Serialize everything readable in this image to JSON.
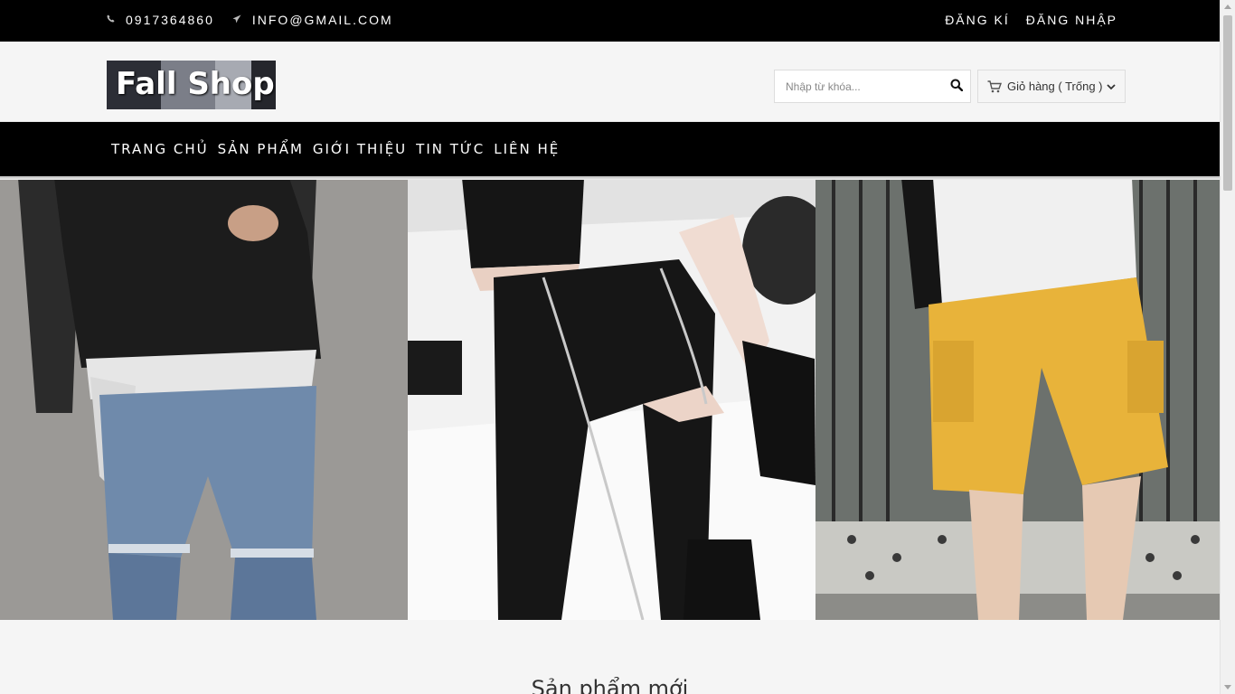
{
  "topbar": {
    "phone": "0917364860",
    "email": "INFO@GMAIL.COM",
    "register_label": "ĐĂNG KÍ",
    "login_label": "ĐĂNG NHẬP"
  },
  "header": {
    "logo_text": "Fall Shop",
    "search_placeholder": "Nhập từ khóa...",
    "cart_label": "Giỏ hàng ( Trống )"
  },
  "nav": {
    "items": [
      {
        "label": "TRANG CHỦ"
      },
      {
        "label": "SẢN PHẨM"
      },
      {
        "label": "GIỚI THIỆU"
      },
      {
        "label": "TIN TỨC"
      },
      {
        "label": "LIÊN HỆ"
      }
    ]
  },
  "section": {
    "title": "Sản phẩm mới"
  },
  "colors": {
    "topbar_bg": "#000000",
    "nav_bg": "#000000",
    "page_bg": "#f5f5f5",
    "shorts_yellow": "#e8b33a"
  },
  "icons": {
    "phone": "phone-icon",
    "email": "paper-plane-icon",
    "search": "search-icon",
    "cart": "cart-icon",
    "dropdown": "chevron-down-icon"
  }
}
